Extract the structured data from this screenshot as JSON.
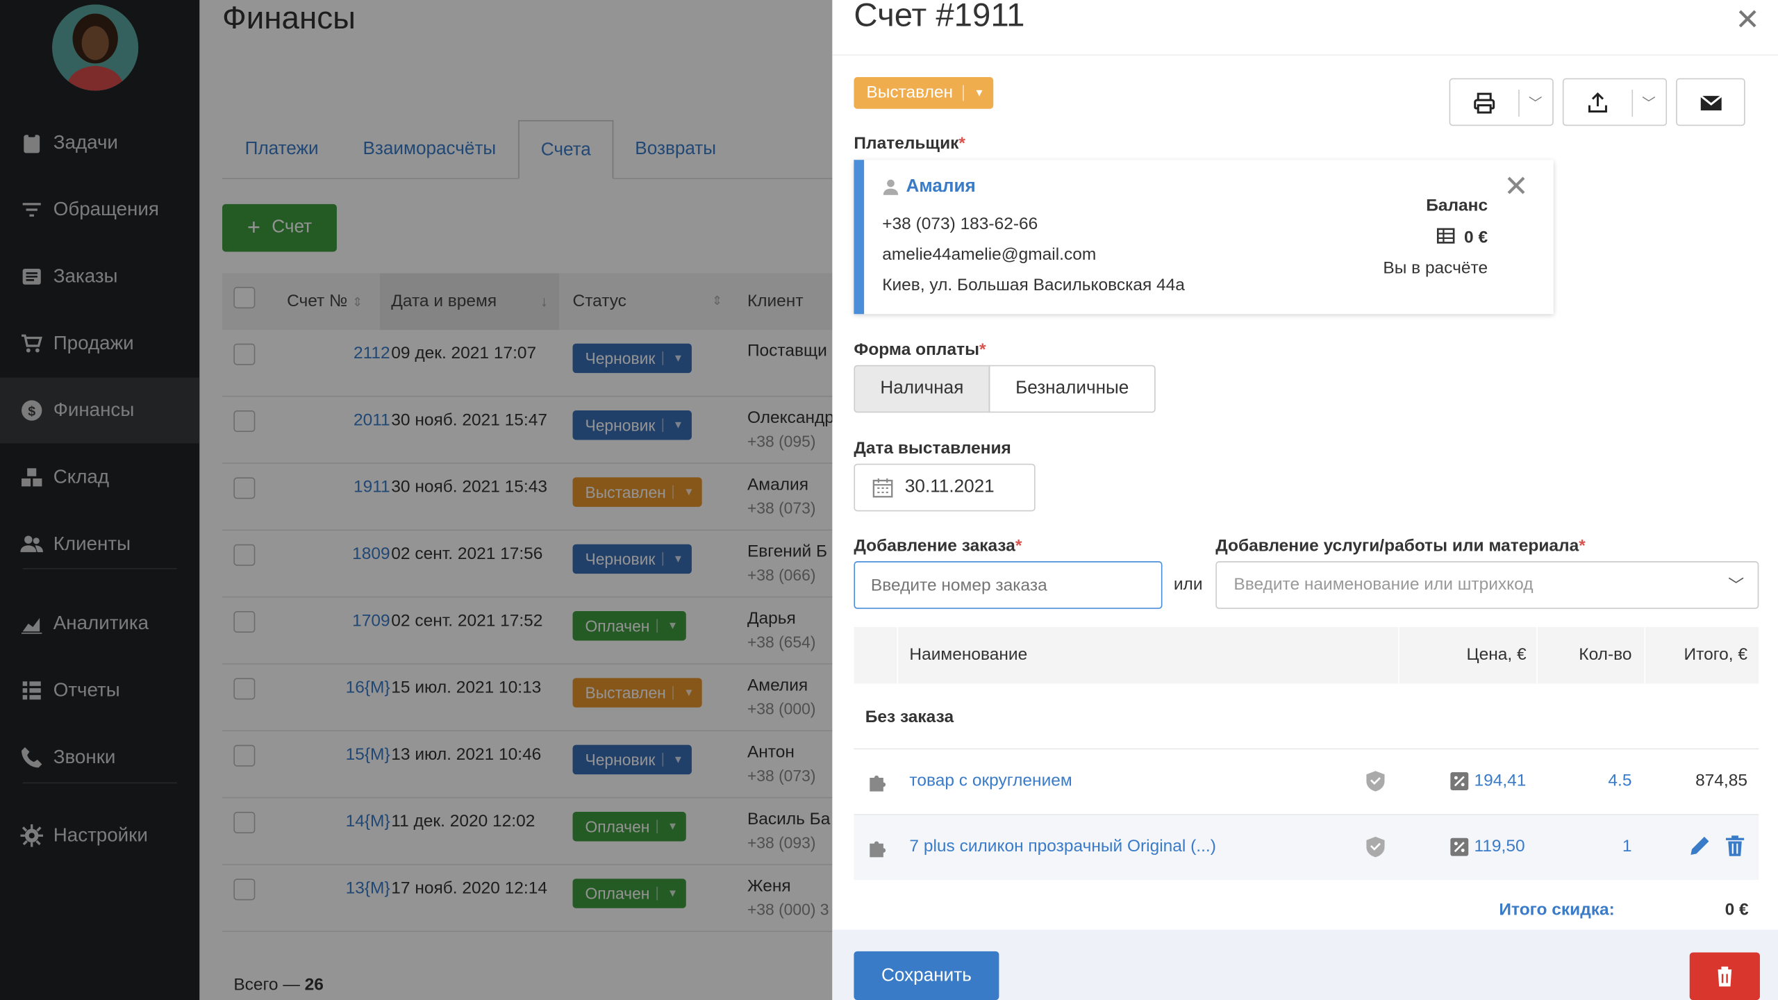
{
  "sidebar": {
    "items": [
      {
        "label": "Задачи",
        "icon": "clipboard-icon"
      },
      {
        "label": "Обращения",
        "icon": "filter-icon"
      },
      {
        "label": "Заказы",
        "icon": "list-icon"
      },
      {
        "label": "Продажи",
        "icon": "cart-icon"
      },
      {
        "label": "Финансы",
        "icon": "dollar-icon"
      },
      {
        "label": "Склад",
        "icon": "boxes-icon"
      },
      {
        "label": "Клиенты",
        "icon": "users-icon"
      },
      {
        "label": "Аналитика",
        "icon": "chart-icon"
      },
      {
        "label": "Отчеты",
        "icon": "report-icon"
      },
      {
        "label": "Звонки",
        "icon": "phone-icon"
      },
      {
        "label": "Настройки",
        "icon": "gear-icon"
      }
    ]
  },
  "main": {
    "title": "Финансы",
    "tabs": [
      "Платежи",
      "Взаиморасчёты",
      "Счета",
      "Возвраты"
    ],
    "add_button": "Счет",
    "columns": [
      "Счет №",
      "Дата и время",
      "Статус",
      "Клиент"
    ],
    "rows": [
      {
        "num": "2112",
        "date": "09 дек. 2021 17:07",
        "status": "Черновик",
        "client": "Поставщи",
        "phone": ""
      },
      {
        "num": "2011",
        "date": "30 нояб. 2021 15:47",
        "status": "Черновик",
        "client": "Олександр",
        "phone": "+38 (095)"
      },
      {
        "num": "1911",
        "date": "30 нояб. 2021 15:43",
        "status": "Выставлен",
        "client": "Амалия",
        "phone": "+38 (073)"
      },
      {
        "num": "1809",
        "date": "02 сент. 2021 17:56",
        "status": "Черновик",
        "client": "Евгений Б",
        "phone": "+38 (066)"
      },
      {
        "num": "1709",
        "date": "02 сент. 2021 17:52",
        "status": "Оплачен",
        "client": "Дарья",
        "phone": "+38 (654)"
      },
      {
        "num": "16{M}",
        "date": "15 июл. 2021 10:13",
        "status": "Выставлен",
        "client": "Амелия",
        "phone": "+38 (000)"
      },
      {
        "num": "15{M}",
        "date": "13 июл. 2021 10:46",
        "status": "Черновик",
        "client": "Антон",
        "phone": "+38 (073)"
      },
      {
        "num": "14{M}",
        "date": "11 дек. 2020 12:02",
        "status": "Оплачен",
        "client": "Василь Ба",
        "phone": "+38 (093)"
      },
      {
        "num": "13{M}",
        "date": "17 нояб. 2020 12:14",
        "status": "Оплачен",
        "client": "Женя",
        "phone": "+38 (000) 3"
      }
    ],
    "total_label": "Всего —",
    "total_value": "26"
  },
  "status_colors": {
    "Черновик": "#3a6fb5",
    "Выставлен": "#e8962e",
    "Оплачен": "#3f9b3f"
  },
  "panel": {
    "title": "Счет #1911",
    "status": "Выставлен",
    "payer_label": "Плательщик",
    "payer": {
      "name": "Амалия",
      "phone": "+38 (073) 183-62-66",
      "email": "amelie44amelie@gmail.com",
      "address": "Киев, ул. Большая Васильковская 44а",
      "balance_label": "Баланс",
      "balance_value": "0 €",
      "balance_status": "Вы в расчёте"
    },
    "payment_label": "Форма оплаты",
    "payment_options": [
      "Наличная",
      "Безналичные"
    ],
    "date_label": "Дата выставления",
    "date_value": "30.11.2021",
    "order_label": "Добавление заказа",
    "order_placeholder": "Введите номер заказа",
    "or_text": "или",
    "service_label": "Добавление услуги/работы или материала",
    "service_placeholder": "Введите наименование или штрихкод",
    "items_columns": [
      "Наименование",
      "Цена, €",
      "Кол-во",
      "Итого, €"
    ],
    "group_label": "Без заказа",
    "items": [
      {
        "name": "товар с округлением",
        "price": "194,41",
        "qty": "4.5",
        "total": "874,85"
      },
      {
        "name": "7 plus силикон прозрачный Original (...)",
        "price": "119,50",
        "qty": "1",
        "total": ""
      }
    ],
    "discount_label": "Итого скидка:",
    "discount_value": "0 €",
    "save_label": "Сохранить"
  }
}
